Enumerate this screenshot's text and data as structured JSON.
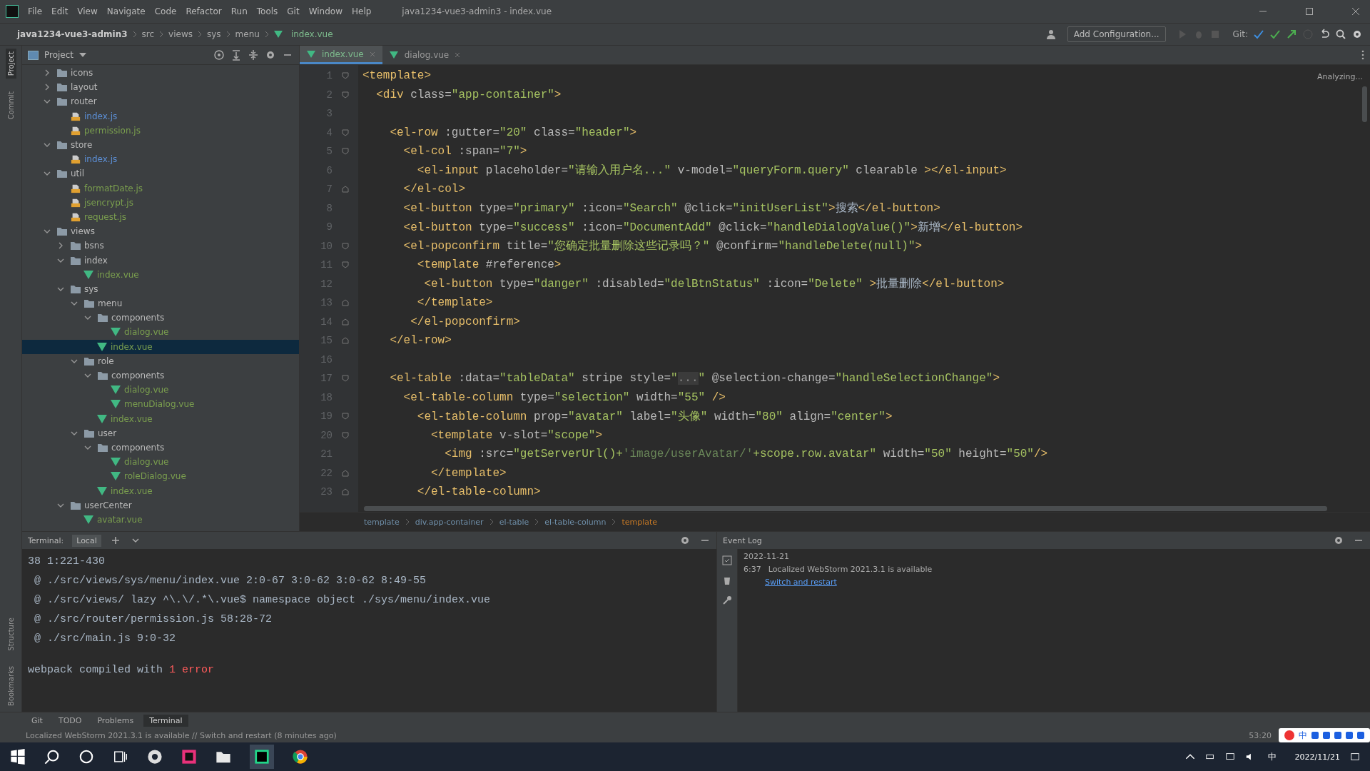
{
  "window": {
    "title": "java1234-vue3-admin3 - index.vue"
  },
  "menu": [
    "File",
    "Edit",
    "View",
    "Navigate",
    "Code",
    "Refactor",
    "Run",
    "Tools",
    "Git",
    "Window",
    "Help"
  ],
  "nav_path": [
    "java1234-vue3-admin3",
    "src",
    "views",
    "sys",
    "menu",
    "index.vue"
  ],
  "toolbar": {
    "run_config": "Add Configuration...",
    "git_label": "Git:"
  },
  "side_stripe": {
    "top": [
      {
        "label": "Project",
        "selected": true
      },
      {
        "label": "Commit",
        "selected": false
      }
    ],
    "bottom": [
      {
        "label": "Structure",
        "selected": false
      },
      {
        "label": "Bookmarks",
        "selected": false
      }
    ]
  },
  "project": {
    "title": "Project",
    "tree": [
      {
        "name": "icons",
        "kind": "folder",
        "expanded": false,
        "selected": false
      },
      {
        "name": "layout",
        "kind": "folder",
        "expanded": false,
        "selected": false
      },
      {
        "name": "router",
        "kind": "folder",
        "expanded": true,
        "selected": false,
        "children": [
          {
            "name": "index.js",
            "kind": "js",
            "color": "#5c8fd6",
            "selected": false
          },
          {
            "name": "permission.js",
            "kind": "js",
            "color": "#7a9e4e",
            "selected": false
          }
        ]
      },
      {
        "name": "store",
        "kind": "folder",
        "expanded": true,
        "selected": false,
        "children": [
          {
            "name": "index.js",
            "kind": "js",
            "color": "#5c8fd6",
            "selected": false
          }
        ]
      },
      {
        "name": "util",
        "kind": "folder",
        "expanded": true,
        "selected": false,
        "children": [
          {
            "name": "formatDate.js",
            "kind": "js",
            "color": "#7a9e4e",
            "selected": false
          },
          {
            "name": "jsencrypt.js",
            "kind": "js",
            "color": "#7a9e4e",
            "selected": false
          },
          {
            "name": "request.js",
            "kind": "js",
            "color": "#7a9e4e",
            "selected": false
          }
        ]
      },
      {
        "name": "views",
        "kind": "folder",
        "expanded": true,
        "selected": false,
        "children": [
          {
            "name": "bsns",
            "kind": "folder",
            "expanded": false,
            "selected": false
          },
          {
            "name": "index",
            "kind": "folder",
            "expanded": true,
            "selected": false,
            "children": [
              {
                "name": "index.vue",
                "kind": "vue",
                "color": "#7a9e4e",
                "selected": false
              }
            ]
          },
          {
            "name": "sys",
            "kind": "folder",
            "expanded": true,
            "selected": false,
            "children": [
              {
                "name": "menu",
                "kind": "folder",
                "expanded": true,
                "selected": false,
                "children": [
                  {
                    "name": "components",
                    "kind": "folder",
                    "expanded": true,
                    "selected": false,
                    "children": [
                      {
                        "name": "dialog.vue",
                        "kind": "vue",
                        "color": "#7a9e4e",
                        "selected": false
                      }
                    ]
                  },
                  {
                    "name": "index.vue",
                    "kind": "vue",
                    "color": "#7a9e4e",
                    "selected": true
                  }
                ]
              },
              {
                "name": "role",
                "kind": "folder",
                "expanded": true,
                "selected": false,
                "children": [
                  {
                    "name": "components",
                    "kind": "folder",
                    "expanded": true,
                    "selected": false,
                    "children": [
                      {
                        "name": "dialog.vue",
                        "kind": "vue",
                        "color": "#7a9e4e",
                        "selected": false
                      },
                      {
                        "name": "menuDialog.vue",
                        "kind": "vue",
                        "color": "#7a9e4e",
                        "selected": false
                      }
                    ]
                  },
                  {
                    "name": "index.vue",
                    "kind": "vue",
                    "color": "#7a9e4e",
                    "selected": false
                  }
                ]
              },
              {
                "name": "user",
                "kind": "folder",
                "expanded": true,
                "selected": false,
                "children": [
                  {
                    "name": "components",
                    "kind": "folder",
                    "expanded": true,
                    "selected": false,
                    "children": [
                      {
                        "name": "dialog.vue",
                        "kind": "vue",
                        "color": "#7a9e4e",
                        "selected": false
                      },
                      {
                        "name": "roleDialog.vue",
                        "kind": "vue",
                        "color": "#7a9e4e",
                        "selected": false
                      }
                    ]
                  },
                  {
                    "name": "index.vue",
                    "kind": "vue",
                    "color": "#7a9e4e",
                    "selected": false
                  }
                ]
              }
            ]
          },
          {
            "name": "userCenter",
            "kind": "folder",
            "expanded": true,
            "selected": false,
            "children": [
              {
                "name": "avatar.vue",
                "kind": "vue",
                "color": "#7a9e4e",
                "selected": false
              }
            ]
          }
        ]
      }
    ]
  },
  "editor_tabs": [
    {
      "label": "index.vue",
      "selected": true
    },
    {
      "label": "dialog.vue",
      "selected": false
    }
  ],
  "editor_status": "Analyzing...",
  "code": [
    {
      "number": "1",
      "kind": "opener",
      "segments": [
        {
          "text": "<template>",
          "kind": "tag"
        }
      ]
    },
    {
      "number": "2",
      "kind": "opener",
      "segments": [
        {
          "text": "  <div",
          "kind": "tag"
        },
        {
          "text": " class=",
          "kind": "attr"
        },
        {
          "text": "\"app-container\"",
          "kind": "string"
        },
        {
          "text": ">",
          "kind": "tag"
        }
      ]
    },
    {
      "number": "3",
      "kind": "plain"
    },
    {
      "number": "4",
      "kind": "opener",
      "segments": [
        {
          "text": "    <el-row",
          "kind": "tag"
        },
        {
          "text": " :gutter=",
          "kind": "attr"
        },
        {
          "text": "\"20\"",
          "kind": "string"
        },
        {
          "text": " class=",
          "kind": "attr"
        },
        {
          "text": "\"header\"",
          "kind": "string"
        },
        {
          "text": ">",
          "kind": "tag"
        }
      ]
    },
    {
      "number": "5",
      "kind": "opener",
      "segments": [
        {
          "text": "      <el-col",
          "kind": "tag"
        },
        {
          "text": " :span=",
          "kind": "attr"
        },
        {
          "text": "\"7\"",
          "kind": "string"
        },
        {
          "text": ">",
          "kind": "tag"
        }
      ]
    },
    {
      "number": "6",
      "kind": "plain",
      "segments": [
        {
          "text": "        <el-input",
          "kind": "tag"
        },
        {
          "text": " placeholder=",
          "kind": "attr"
        },
        {
          "text": "\"请输入用户名...\"",
          "kind": "string"
        },
        {
          "text": " v-model=",
          "kind": "attr"
        },
        {
          "text": "\"queryForm.query\"",
          "kind": "string"
        },
        {
          "text": " clearable ",
          "kind": "attr"
        },
        {
          "text": "></el-input>",
          "kind": "tag"
        }
      ]
    },
    {
      "number": "7",
      "kind": "closer",
      "segments": [
        {
          "text": "      </el-col>",
          "kind": "tag"
        }
      ]
    },
    {
      "number": "8",
      "kind": "plain",
      "segments": [
        {
          "text": "      <el-button",
          "kind": "tag"
        },
        {
          "text": " type=",
          "kind": "attr"
        },
        {
          "text": "\"primary\"",
          "kind": "string"
        },
        {
          "text": " :icon=",
          "kind": "attr"
        },
        {
          "text": "\"Search\"",
          "kind": "string"
        },
        {
          "text": " @click=",
          "kind": "attr"
        },
        {
          "text": "\"initUserList\"",
          "kind": "string"
        },
        {
          "text": ">",
          "kind": "tag"
        },
        {
          "text": "搜索",
          "kind": "plain"
        },
        {
          "text": "</el-button>",
          "kind": "tag"
        }
      ]
    },
    {
      "number": "9",
      "kind": "plain",
      "segments": [
        {
          "text": "      <el-button",
          "kind": "tag"
        },
        {
          "text": " type=",
          "kind": "attr"
        },
        {
          "text": "\"success\"",
          "kind": "string"
        },
        {
          "text": " :icon=",
          "kind": "attr"
        },
        {
          "text": "\"DocumentAdd\"",
          "kind": "string"
        },
        {
          "text": " @click=",
          "kind": "attr"
        },
        {
          "text": "\"handleDialogValue()\"",
          "kind": "string"
        },
        {
          "text": ">",
          "kind": "tag"
        },
        {
          "text": "新增",
          "kind": "plain"
        },
        {
          "text": "</el-button>",
          "kind": "tag"
        }
      ]
    },
    {
      "number": "10",
      "kind": "opener",
      "segments": [
        {
          "text": "      <el-popconfirm",
          "kind": "tag"
        },
        {
          "text": " title=",
          "kind": "attr"
        },
        {
          "text": "\"您确定批量删除这些记录吗？\"",
          "kind": "string"
        },
        {
          "text": " @confirm=",
          "kind": "attr"
        },
        {
          "text": "\"handleDelete(null)\"",
          "kind": "string"
        },
        {
          "text": ">",
          "kind": "tag"
        }
      ]
    },
    {
      "number": "11",
      "kind": "opener",
      "segments": [
        {
          "text": "        <template",
          "kind": "tag"
        },
        {
          "text": " #reference",
          "kind": "attr"
        },
        {
          "text": ">",
          "kind": "tag"
        }
      ]
    },
    {
      "number": "12",
      "kind": "plain",
      "segments": [
        {
          "text": "         <el-button",
          "kind": "tag"
        },
        {
          "text": " type=",
          "kind": "attr"
        },
        {
          "text": "\"danger\"",
          "kind": "string"
        },
        {
          "text": " :disabled=",
          "kind": "attr"
        },
        {
          "text": "\"delBtnStatus\"",
          "kind": "string"
        },
        {
          "text": " :icon=",
          "kind": "attr"
        },
        {
          "text": "\"Delete\"",
          "kind": "string"
        },
        {
          "text": " >",
          "kind": "tag"
        },
        {
          "text": "批量删除",
          "kind": "plain"
        },
        {
          "text": "</el-button>",
          "kind": "tag"
        }
      ]
    },
    {
      "number": "13",
      "kind": "closer",
      "segments": [
        {
          "text": "        </template>",
          "kind": "tag"
        }
      ]
    },
    {
      "number": "14",
      "kind": "closer",
      "segments": [
        {
          "text": "       </el-popconfirm>",
          "kind": "tag"
        }
      ]
    },
    {
      "number": "15",
      "kind": "closer",
      "segments": [
        {
          "text": "    </el-row>",
          "kind": "tag"
        }
      ]
    },
    {
      "number": "16",
      "kind": "plain"
    },
    {
      "number": "17",
      "kind": "opener",
      "segments": [
        {
          "text": "    <el-table",
          "kind": "tag"
        },
        {
          "text": " :data=",
          "kind": "attr"
        },
        {
          "text": "\"tableData\"",
          "kind": "string"
        },
        {
          "text": " stripe style=",
          "kind": "attr"
        },
        {
          "text": "\"",
          "kind": "string"
        },
        {
          "text": "...",
          "kind": "fold"
        },
        {
          "text": "\"",
          "kind": "string"
        },
        {
          "text": " @selection-change=",
          "kind": "attr"
        },
        {
          "text": "\"handleSelectionChange\"",
          "kind": "string"
        },
        {
          "text": ">",
          "kind": "tag"
        }
      ]
    },
    {
      "number": "18",
      "kind": "plain",
      "segments": [
        {
          "text": "      <el-table-column",
          "kind": "tag"
        },
        {
          "text": " type=",
          "kind": "attr"
        },
        {
          "text": "\"selection\"",
          "kind": "string"
        },
        {
          "text": " width=",
          "kind": "attr"
        },
        {
          "text": "\"55\"",
          "kind": "string"
        },
        {
          "text": " />",
          "kind": "tag"
        }
      ]
    },
    {
      "number": "19",
      "kind": "opener",
      "segments": [
        {
          "text": "        <el-table-column",
          "kind": "tag"
        },
        {
          "text": " prop=",
          "kind": "attr"
        },
        {
          "text": "\"avatar\"",
          "kind": "string"
        },
        {
          "text": " label=",
          "kind": "attr"
        },
        {
          "text": "\"头像\"",
          "kind": "string"
        },
        {
          "text": " width=",
          "kind": "attr"
        },
        {
          "text": "\"80\"",
          "kind": "string"
        },
        {
          "text": " align=",
          "kind": "attr"
        },
        {
          "text": "\"center\"",
          "kind": "string"
        },
        {
          "text": ">",
          "kind": "tag"
        }
      ]
    },
    {
      "number": "20",
      "kind": "opener",
      "segments": [
        {
          "text": "          <template",
          "kind": "tag"
        },
        {
          "text": " v-slot=",
          "kind": "attr"
        },
        {
          "text": "\"scope\"",
          "kind": "string"
        },
        {
          "text": ">",
          "kind": "tag"
        }
      ]
    },
    {
      "number": "21",
      "kind": "plain",
      "segments": [
        {
          "text": "            <img",
          "kind": "tag"
        },
        {
          "text": " :src=",
          "kind": "attr"
        },
        {
          "text": "\"getServerUrl()+",
          "kind": "string"
        },
        {
          "text": "'image/userAvatar/'",
          "kind": "quote"
        },
        {
          "text": "+scope.row.avatar\"",
          "kind": "string"
        },
        {
          "text": " width=",
          "kind": "attr"
        },
        {
          "text": "\"50\"",
          "kind": "string"
        },
        {
          "text": " height=",
          "kind": "attr"
        },
        {
          "text": "\"50\"",
          "kind": "string"
        },
        {
          "text": "/>",
          "kind": "tag"
        }
      ]
    },
    {
      "number": "22",
      "kind": "closer",
      "segments": [
        {
          "text": "          </template>",
          "kind": "tag"
        }
      ]
    },
    {
      "number": "23",
      "kind": "closer",
      "segments": [
        {
          "text": "        </el-table-column>",
          "kind": "tag"
        }
      ]
    }
  ],
  "editor_breadcrumb": [
    "template",
    "div.app-container",
    "el-table",
    "el-table-column",
    "template"
  ],
  "terminal": {
    "title": "Terminal:",
    "session": "Local",
    "lines": [
      {
        "kind": "log",
        "segments": [
          {
            "text": "38 1:221-430",
            "kind": "plain"
          }
        ]
      },
      {
        "kind": "log",
        "segments": [
          {
            "text": " @ ./src/views/sys/menu/index.vue 2:0-67 3:0-62 3:0-62 8:49-55",
            "kind": "plain"
          }
        ]
      },
      {
        "kind": "log",
        "segments": [
          {
            "text": " @ ./src/views/ lazy ^\\.\\/.*\\.vue$ namespace object ./sys/menu/index.vue",
            "kind": "plain"
          }
        ]
      },
      {
        "kind": "log",
        "segments": [
          {
            "text": " @ ./src/router/permission.js 58:28-72",
            "kind": "plain"
          }
        ]
      },
      {
        "kind": "log",
        "segments": [
          {
            "text": " @ ./src/main.js 9:0-32",
            "kind": "plain"
          }
        ]
      },
      {
        "kind": "summary",
        "segments": [
          {
            "text": "webpack compiled with ",
            "kind": "plain"
          },
          {
            "text": "1 error",
            "kind": "error"
          }
        ]
      }
    ]
  },
  "event_log": {
    "title": "Event Log",
    "date": "2022-11-21",
    "time": "6:37",
    "message": "Localized WebStorm 2021.3.1 is available",
    "link": "Switch and restart"
  },
  "tool_tabs": [
    {
      "label": "Git",
      "selected": false
    },
    {
      "label": "TODO",
      "selected": false
    },
    {
      "label": "Problems",
      "selected": false
    },
    {
      "label": "Terminal",
      "selected": true
    }
  ],
  "status_bar": {
    "message": "Localized WebStorm 2021.3.1 is available // Switch and restart (8 minutes ago)",
    "position": "53:20"
  },
  "ime": {
    "label": "中"
  },
  "taskbar": {
    "tray_label": "中",
    "date": "2022/11/21"
  }
}
